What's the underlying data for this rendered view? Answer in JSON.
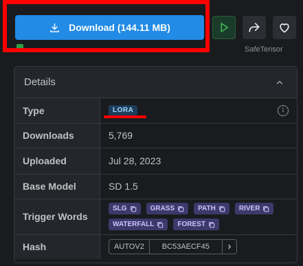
{
  "toolbar": {
    "download_label": "Download (144.11 MB)",
    "safetensor_label": "SafeTensor",
    "icons": {
      "download": "download-icon",
      "play": "play-icon",
      "share": "share-icon",
      "like": "heart-icon"
    },
    "accent": "#228be6"
  },
  "details": {
    "title": "Details",
    "rows": {
      "type": {
        "label": "Type",
        "value": "LORA"
      },
      "downloads": {
        "label": "Downloads",
        "value": "5,769"
      },
      "uploaded": {
        "label": "Uploaded",
        "value": "Jul 28, 2023"
      },
      "base_model": {
        "label": "Base Model",
        "value": "SD 1.5"
      },
      "trigger_words": {
        "label": "Trigger Words",
        "words": [
          "SLG",
          "GRASS",
          "PATH",
          "RIVER",
          "WATERFALL",
          "FOREST"
        ]
      },
      "hash": {
        "label": "Hash",
        "algorithm": "AUTOV2",
        "value": "BC53AECF45"
      }
    }
  },
  "annotations": {
    "highlight_color": "#ff0000"
  }
}
